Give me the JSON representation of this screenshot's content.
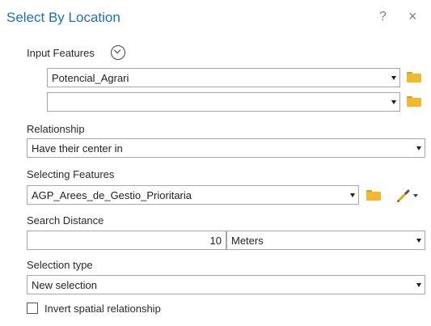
{
  "window": {
    "title": "Select By Location",
    "help": "?",
    "close": "×"
  },
  "input_features": {
    "label": "Input Features",
    "rows": [
      {
        "value": "Potencial_Agrari"
      },
      {
        "value": ""
      }
    ]
  },
  "relationship": {
    "label": "Relationship",
    "value": "Have their center in"
  },
  "selecting_features": {
    "label": "Selecting Features",
    "value": "AGP_Arees_de_Gestio_Prioritaria"
  },
  "search_distance": {
    "label": "Search Distance",
    "value": "10",
    "unit": "Meters"
  },
  "selection_type": {
    "label": "Selection type",
    "value": "New selection"
  },
  "invert": {
    "label": "Invert spatial relationship",
    "checked": false
  },
  "colors": {
    "title": "#1f6fb2",
    "folder": "#f2b92e",
    "border": "#a8a8a8"
  }
}
